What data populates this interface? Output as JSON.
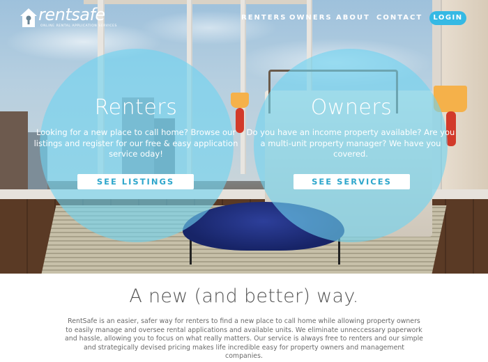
{
  "brand": {
    "name": "rentsafe",
    "tagline": "ONLINE RENTAL APPLICATION SERVICES"
  },
  "nav": {
    "items": [
      "RENTERS",
      "OWNERS",
      "ABOUT",
      "CONTACT"
    ],
    "login": "LOGIN"
  },
  "hero": {
    "renters": {
      "title": "Renters",
      "text": "Looking for a new place to call home? Browse our listings and register for our free & easy application service oday!",
      "cta": "SEE LISTINGS"
    },
    "owners": {
      "title": "Owners",
      "text": "Do you have an income property available? Are you a multi-unit property manager? We have you covered.",
      "cta": "SEE SERVICES"
    }
  },
  "intro": {
    "title": "A new (and better) way.",
    "body": "RentSafe is an easier, safer way for renters to find a new place to call home while allowing property owners to easily manage and oversee rental applications and available units. We eliminate unneccessary paperwork and hassle, allowing you to focus on what really matters. Our service is always free to renters and our simple and strategically devised pricing makes life incredible easy for property owners and management companies."
  },
  "colors": {
    "accent": "#35b9e4",
    "circle": "#70d3f0",
    "cta_text": "#2fa7cc"
  }
}
